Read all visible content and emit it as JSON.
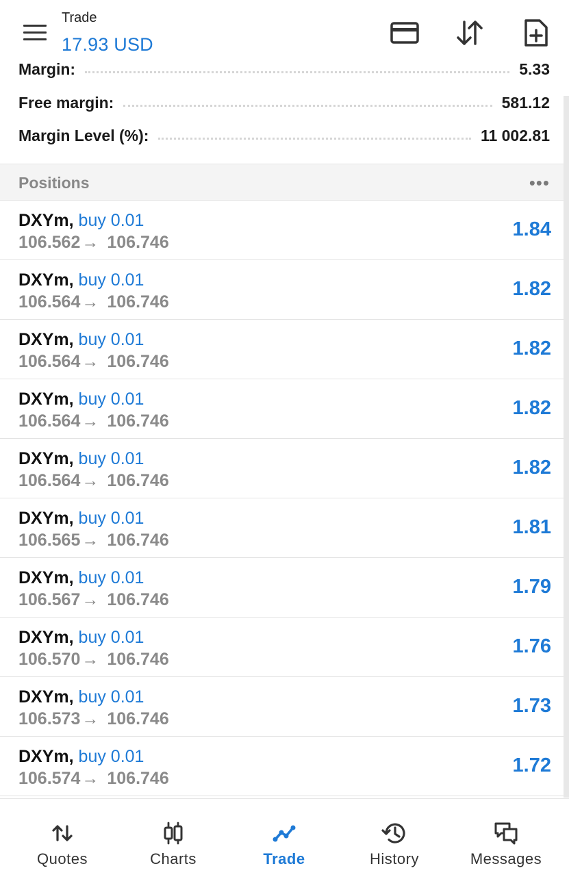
{
  "header": {
    "title": "Trade",
    "balance": "17.93 USD",
    "icons": [
      "menu-icon",
      "card-icon",
      "sort-icon",
      "new-order-icon"
    ]
  },
  "account": {
    "rows": [
      {
        "label": "Margin:",
        "value": "5.33"
      },
      {
        "label": "Free margin:",
        "value": "581.12"
      },
      {
        "label": "Margin Level (%):",
        "value": "11 002.81"
      }
    ]
  },
  "positions": {
    "header": "Positions",
    "more": "•••",
    "arrow": "→",
    "items": [
      {
        "symbol": "DXYm,",
        "side": "buy 0.01",
        "open": "106.562",
        "current": "106.746",
        "profit": "1.84"
      },
      {
        "symbol": "DXYm,",
        "side": "buy 0.01",
        "open": "106.564",
        "current": "106.746",
        "profit": "1.82"
      },
      {
        "symbol": "DXYm,",
        "side": "buy 0.01",
        "open": "106.564",
        "current": "106.746",
        "profit": "1.82"
      },
      {
        "symbol": "DXYm,",
        "side": "buy 0.01",
        "open": "106.564",
        "current": "106.746",
        "profit": "1.82"
      },
      {
        "symbol": "DXYm,",
        "side": "buy 0.01",
        "open": "106.564",
        "current": "106.746",
        "profit": "1.82"
      },
      {
        "symbol": "DXYm,",
        "side": "buy 0.01",
        "open": "106.565",
        "current": "106.746",
        "profit": "1.81"
      },
      {
        "symbol": "DXYm,",
        "side": "buy 0.01",
        "open": "106.567",
        "current": "106.746",
        "profit": "1.79"
      },
      {
        "symbol": "DXYm,",
        "side": "buy 0.01",
        "open": "106.570",
        "current": "106.746",
        "profit": "1.76"
      },
      {
        "symbol": "DXYm,",
        "side": "buy 0.01",
        "open": "106.573",
        "current": "106.746",
        "profit": "1.73"
      },
      {
        "symbol": "DXYm,",
        "side": "buy 0.01",
        "open": "106.574",
        "current": "106.746",
        "profit": "1.72"
      }
    ]
  },
  "nav": {
    "items": [
      {
        "label": "Quotes",
        "icon": "quotes-icon"
      },
      {
        "label": "Charts",
        "icon": "charts-icon"
      },
      {
        "label": "Trade",
        "icon": "trade-icon",
        "active": true
      },
      {
        "label": "History",
        "icon": "history-icon"
      },
      {
        "label": "Messages",
        "icon": "messages-icon"
      }
    ]
  },
  "colors": {
    "accent": "#1e7ad6",
    "text": "#1a1a1a",
    "muted": "#8a8a8a",
    "divider": "#e3e3e3",
    "section_bg": "#f4f4f4"
  }
}
